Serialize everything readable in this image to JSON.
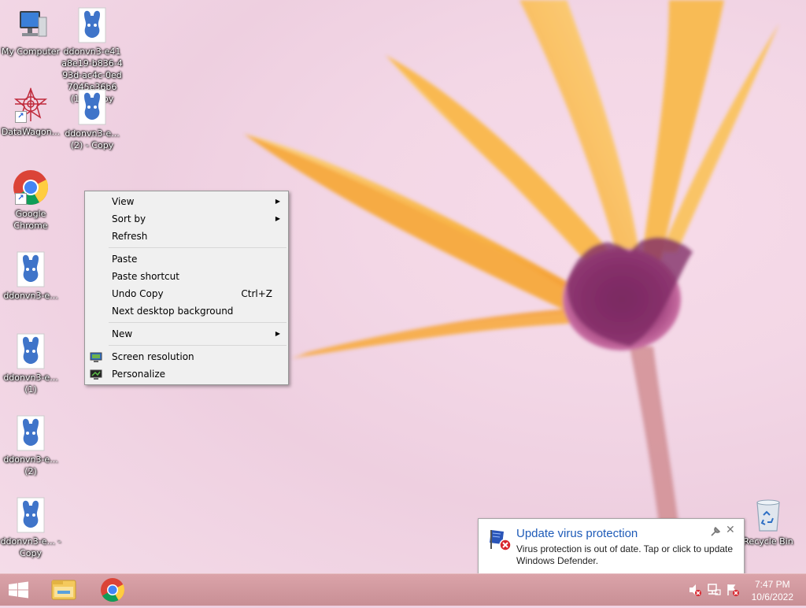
{
  "desktop_icons": [
    {
      "name": "my-computer",
      "label": "My Computer",
      "icon": "computer-icon"
    },
    {
      "name": "ddonvn-doc-1",
      "label": "ddonvn3-e41 a8e19-b836-4 93d-ac4c-0ed 7045e36b6 (1) - Copy",
      "icon": "bfdi-character-icon"
    },
    {
      "name": "datawagon",
      "label": "DataWagon...",
      "icon": "datawagon-icon"
    },
    {
      "name": "ddonvn-doc-2",
      "label": "ddonvn3-e... (2) - Copy",
      "icon": "bfdi-character-icon"
    },
    {
      "name": "google-chrome",
      "label": "Google Chrome",
      "icon": "chrome-icon"
    },
    {
      "name": "ddonvn-doc-3",
      "label": "ddonvn3-e...",
      "icon": "bfdi-character-icon"
    },
    {
      "name": "ddonvn-doc-4",
      "label": "ddonvn3-e... (1)",
      "icon": "bfdi-character-icon"
    },
    {
      "name": "ddonvn-doc-5",
      "label": "ddonvn3-e... (2)",
      "icon": "bfdi-character-icon"
    },
    {
      "name": "ddonvn-doc-6",
      "label": "ddonvn3-e... - Copy",
      "icon": "bfdi-character-icon"
    },
    {
      "name": "recycle-bin",
      "label": "Recycle Bin",
      "icon": "recycle-bin-icon"
    }
  ],
  "context_menu": {
    "items": [
      {
        "label": "View",
        "submenu": true
      },
      {
        "label": "Sort by",
        "submenu": true
      },
      {
        "label": "Refresh"
      },
      {
        "label": "Paste"
      },
      {
        "label": "Paste shortcut"
      },
      {
        "label": "Undo Copy",
        "shortcut": "Ctrl+Z"
      },
      {
        "label": "Next desktop background"
      },
      {
        "label": "New",
        "submenu": true
      },
      {
        "label": "Screen resolution",
        "icon": "display-icon"
      },
      {
        "label": "Personalize",
        "icon": "personalize-icon"
      }
    ]
  },
  "notification": {
    "title": "Update virus protection",
    "message": "Virus protection is out of date. Tap or click to update Windows Defender.",
    "icon": "defender-warning-icon"
  },
  "taskbar": {
    "time": "7:47 PM",
    "date": "10/6/2022",
    "pinned": [
      "start-icon",
      "file-explorer-icon",
      "chrome-icon"
    ],
    "tray": [
      "volume-muted-icon",
      "network-icon",
      "action-center-warning-icon"
    ]
  },
  "colors": {
    "accent_blue": "#1e5bb8",
    "taskbar": "#d39aa0",
    "petal": "#f7b13e",
    "flower_center": "#8a2a6a"
  }
}
